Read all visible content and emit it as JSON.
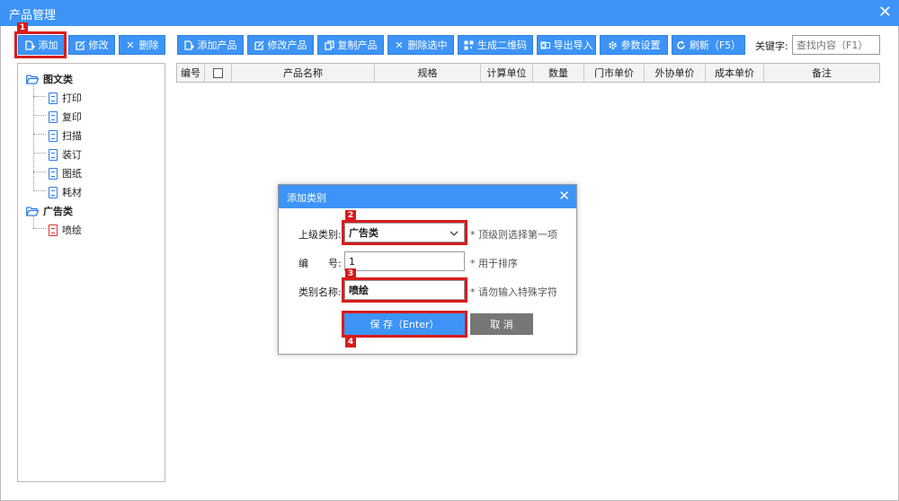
{
  "window": {
    "title": "产品管理",
    "close_icon": "close-icon"
  },
  "category_toolbar": {
    "add_label": "添加",
    "edit_label": "修改",
    "delete_label": "删除"
  },
  "product_toolbar": {
    "add_product": "添加产品",
    "edit_product": "修改产品",
    "copy_product": "复制产品",
    "delete_selected": "删除选中",
    "gen_qrcode": "生成二维码",
    "export_import": "导出导入",
    "settings": "参数设置",
    "refresh": "刷新（F5）"
  },
  "search": {
    "label": "关键字:",
    "placeholder": "查找内容（F1）"
  },
  "tree": {
    "categories": [
      {
        "label": "图文类",
        "children": [
          "打印",
          "复印",
          "扫描",
          "装订",
          "图纸",
          "耗材"
        ]
      },
      {
        "label": "广告类",
        "children": [
          "喷绘"
        ]
      }
    ]
  },
  "grid": {
    "columns": [
      "编号",
      "",
      "产品名称",
      "规格",
      "计算单位",
      "数量",
      "门市单价",
      "外协单价",
      "成本单价",
      "备注"
    ]
  },
  "dialog": {
    "title": "添加类别",
    "parent_label": "上级类别:",
    "parent_value": "广告类",
    "parent_hint": "* 顶级则选择第一项",
    "code_label": "编　　号:",
    "code_value": "1",
    "code_hint": "* 用于排序",
    "name_label": "类别名称:",
    "name_value": "喷绘",
    "name_hint": "* 请勿输入特殊字符",
    "save_label": "保 存（Enter）",
    "cancel_label": "取 消"
  },
  "markers": [
    "1",
    "2",
    "3",
    "4"
  ],
  "colors": {
    "accent": "#3d94f6",
    "highlight": "#d81b1b",
    "cancel": "#777777"
  }
}
